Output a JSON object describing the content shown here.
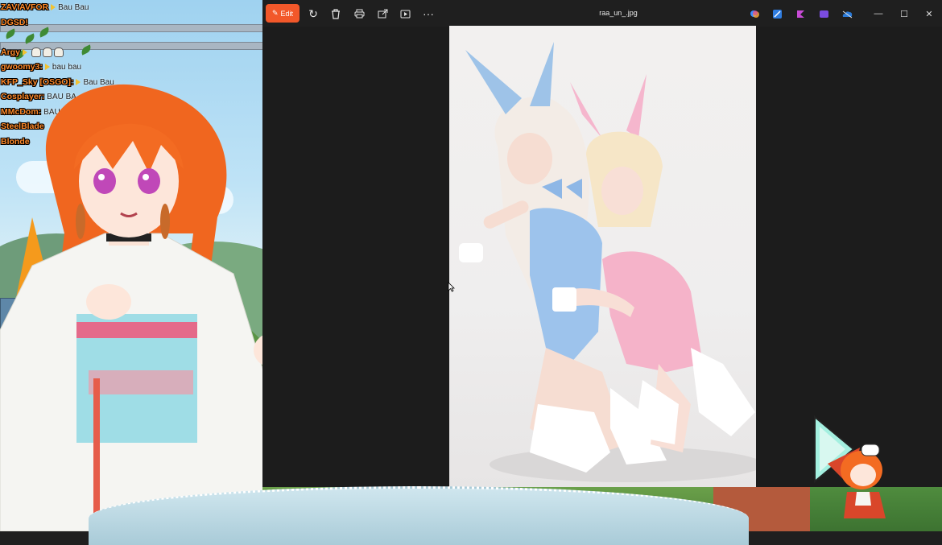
{
  "chat": [
    {
      "user": "ZAVIAVFOR",
      "msg": "Bau Bau",
      "arrow": true
    },
    {
      "user": "DGSD!",
      "msg": "",
      "arrow": false
    },
    {
      "user": "",
      "msg": "",
      "arrow": false
    },
    {
      "user": "Argy",
      "msg": "",
      "arrow": true,
      "skulls": 3
    },
    {
      "user": "gwoomy3:",
      "msg": "bau bau",
      "arrow": true
    },
    {
      "user": "KFP_Sky [OSGO]:",
      "msg": "Bau Bau",
      "arrow": true
    },
    {
      "user": "Cosplayer:",
      "msg": "BAU BA",
      "arrow": false
    },
    {
      "user": "MMcDom:",
      "msg": "BAU",
      "arrow": false
    },
    {
      "user": "SteelBlade",
      "msg": "",
      "arrow": false
    },
    {
      "user": "Blonde",
      "msg": "",
      "arrow": false
    }
  ],
  "toolbar": {
    "edit_label": "Edit",
    "title": "raa_un_.jpg",
    "more_label": "···"
  },
  "colors": {
    "edit_accent": "#f2582a",
    "window_bg": "#1f1f1f"
  }
}
